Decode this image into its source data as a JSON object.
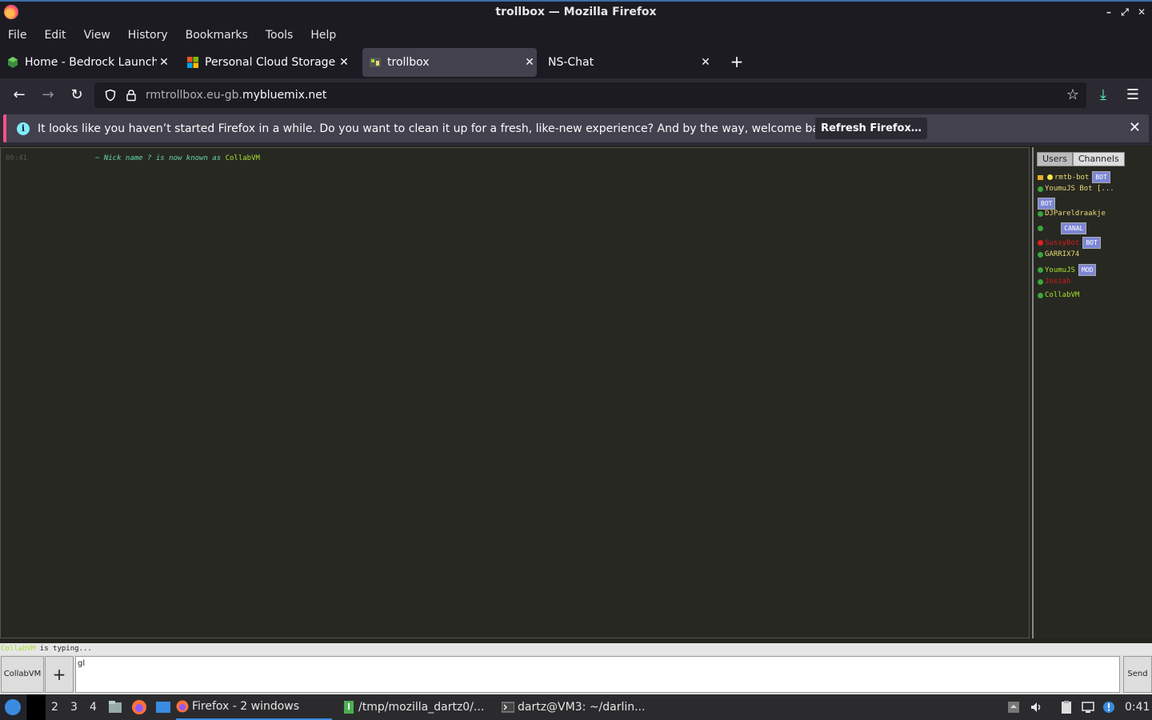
{
  "window": {
    "title": "trollbox — Mozilla Firefox",
    "minimize_glyph": "–",
    "maximize_glyph": "⤢",
    "close_glyph": "✕"
  },
  "menu": [
    "File",
    "Edit",
    "View",
    "History",
    "Bookmarks",
    "Tools",
    "Help"
  ],
  "tabs": [
    {
      "label": "Home - Bedrock Launcher",
      "icon": "bedrock-cube-icon",
      "active": false
    },
    {
      "label": "Personal Cloud Storage - ",
      "icon": "microsoft-logo-icon",
      "active": false
    },
    {
      "label": "trollbox",
      "icon": "trollbox-icon",
      "active": true
    },
    {
      "label": "NS-Chat",
      "icon": "",
      "active": false
    }
  ],
  "tab_close_glyph": "✕",
  "new_tab_glyph": "+",
  "nav": {
    "back_glyph": "←",
    "forward_glyph": "→",
    "reload_glyph": "↻",
    "url_host": "rmtrollbox.eu-gb.",
    "url_domain": "mybluemix.net",
    "bookmark_glyph": "☆",
    "downloads_glyph": "⤓",
    "menu_glyph": "☰"
  },
  "notification": {
    "info_glyph": "i",
    "text": "It looks like you haven’t started Firefox in a while. Do you want to clean it up for a fresh, like-new experience? And by the way, welcome back!",
    "button": "Refresh Firefox…",
    "close_glyph": "✕"
  },
  "chat": {
    "messages": [
      {
        "time": "00:41",
        "prefix": "~ Nick name ? is now known as ",
        "nick": "CollabVM"
      }
    ]
  },
  "sidebar": {
    "tabs": [
      "Users",
      "Channels"
    ],
    "users": [
      {
        "name": "rmtb-bot",
        "color": "#e6db74",
        "dot": "#f5e642",
        "badge": "BOT",
        "lock": true
      },
      {
        "name": "YoumuJS Bot [...",
        "color": "#e6db74",
        "dot": "#3aa63a",
        "badge": "",
        "lock": false
      },
      {
        "name": "",
        "color": "#e6db74",
        "dot": "",
        "badge": "BOT",
        "lock": false
      },
      {
        "name": "DJPareldraakje",
        "color": "#e6db74",
        "dot": "#3aa63a",
        "badge": "",
        "lock": false
      },
      {
        "name": "   ",
        "color": "#1a1a8a",
        "dot": "#3aa63a",
        "badge": "CANAL",
        "lock": false
      },
      {
        "name": "SussyBot",
        "color": "#d81b1b",
        "dot": "#e02020",
        "badge": "BOT",
        "lock": false
      },
      {
        "name": "GARRIX74",
        "color": "#e6db74",
        "dot": "#3aa63a",
        "badge": "",
        "lock": false
      },
      {
        "name": "YoumuJS",
        "color": "#a6e22e",
        "dot": "#3aa63a",
        "badge": "MOD",
        "lock": false
      },
      {
        "name": "Josiah",
        "color": "#d81b1b",
        "dot": "#3aa63a",
        "badge": "",
        "lock": false
      },
      {
        "name": "CollabVM",
        "color": "#a6e22e",
        "dot": "#3aa63a",
        "badge": "",
        "lock": false
      }
    ]
  },
  "typing": {
    "nick": "CollabVM",
    "text": " is typing..."
  },
  "input": {
    "nick_label": "CollabVM",
    "plus_glyph": "+",
    "value": "gl",
    "send_label": "Send"
  },
  "taskbar": {
    "workspaces": [
      "2",
      "3",
      "4"
    ],
    "tasks": [
      {
        "label": "Firefox - 2 windows",
        "icon": "firefox-icon",
        "active": true
      },
      {
        "label": "/tmp/mozilla_dartz0/...",
        "icon": "archive-icon",
        "active": false
      },
      {
        "label": "dartz@VM3: ~/darlin...",
        "icon": "terminal-icon",
        "active": false
      }
    ],
    "clock": "0:41"
  }
}
